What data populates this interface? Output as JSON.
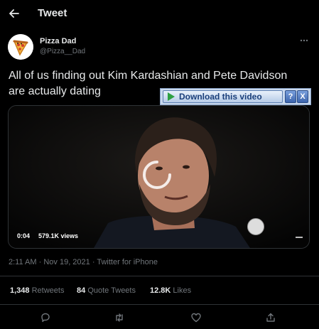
{
  "header": {
    "title": "Tweet"
  },
  "author": {
    "name": "Pizza Dad",
    "handle": "@Pizza__Dad"
  },
  "tweet": {
    "text_line1": "All of us finding out Kim Kardashian and Pete Davidson",
    "text_line2": "are actually dating"
  },
  "video": {
    "time": "0:04",
    "views": "579.1K views"
  },
  "download_overlay": {
    "label": "Download this video",
    "help": "?",
    "close": "X"
  },
  "meta": {
    "time": "2:11 AM",
    "separator": "·",
    "date": "Nov 19, 2021",
    "source": "Twitter for iPhone"
  },
  "stats": {
    "retweets": {
      "count": "1,348",
      "label": "Retweets"
    },
    "quotes": {
      "count": "84",
      "label": "Quote Tweets"
    },
    "likes": {
      "count": "12.8K",
      "label": "Likes"
    }
  },
  "icons": {
    "back": "arrow-left-icon",
    "more": "more-dots-icon",
    "reply": "reply-icon",
    "retweet": "retweet-icon",
    "like": "heart-icon",
    "share": "share-icon"
  }
}
